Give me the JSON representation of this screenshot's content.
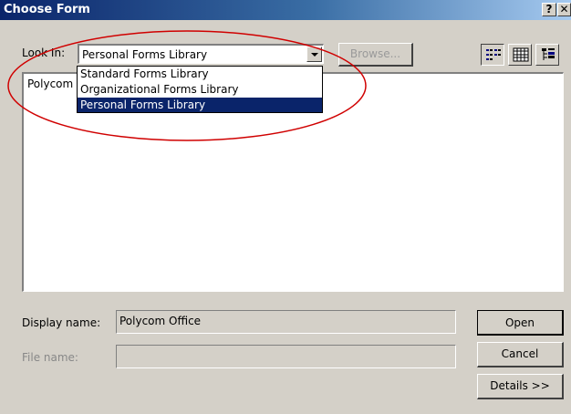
{
  "window": {
    "title": "Choose Form",
    "help_label": "?",
    "close_label": "✕"
  },
  "toolbar": {
    "look_in_label": "Look In:",
    "look_in_value": "Personal Forms Library",
    "browse_label": "Browse...",
    "view_buttons": [
      "large-icons-view-icon",
      "list-view-icon",
      "details-view-icon"
    ]
  },
  "dropdown": {
    "options": [
      "Standard Forms Library",
      "Organizational Forms Library",
      "Personal Forms Library"
    ],
    "selected_index": 2
  },
  "list": {
    "items": [
      "Polycom"
    ]
  },
  "fields": {
    "display_name_label": "Display name:",
    "display_name_value": "Polycom Office",
    "file_name_label": "File name:",
    "file_name_value": ""
  },
  "buttons": {
    "open_label": "Open",
    "cancel_label": "Cancel",
    "details_label": "Details >>"
  },
  "colors": {
    "dialog_bg": "#d4d0c8",
    "selection": "#0a246a",
    "annotation": "#d00000"
  }
}
